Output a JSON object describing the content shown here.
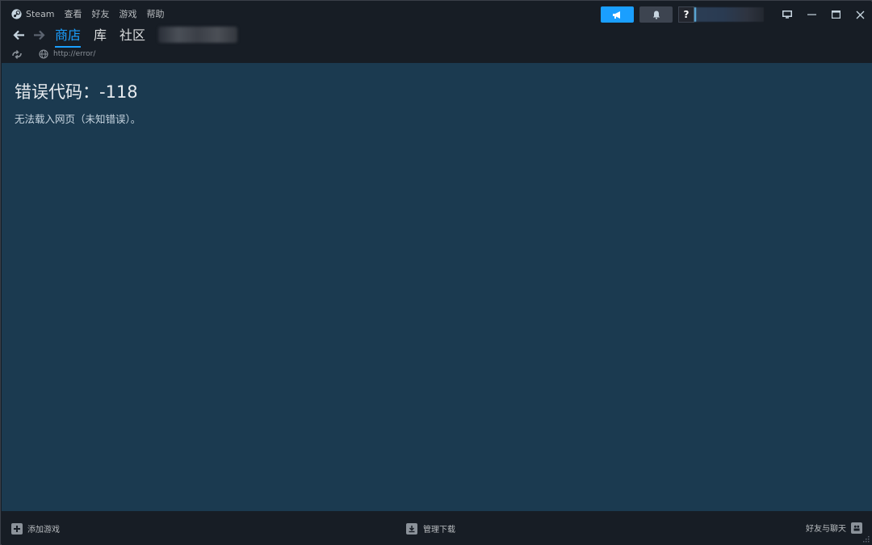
{
  "app": {
    "name": "Steam"
  },
  "menu": {
    "items": [
      "查看",
      "好友",
      "游戏",
      "帮助"
    ]
  },
  "account": {
    "help_label": "?"
  },
  "nav": {
    "tabs": [
      {
        "label": "商店",
        "active": true
      },
      {
        "label": "库",
        "active": false
      },
      {
        "label": "社区",
        "active": false
      }
    ]
  },
  "url": {
    "value": "http://error/"
  },
  "error": {
    "title": "错误代码：-118",
    "message": "无法载入网页（未知错误）。"
  },
  "footer": {
    "add_game": "添加游戏",
    "manage_downloads": "管理下载",
    "friends_chat": "好友与聊天"
  },
  "colors": {
    "accent": "#1a9fff",
    "content_bg": "#1b3a50",
    "chrome_bg": "#171d25"
  },
  "icons": {
    "steam": "steam-logo-icon",
    "announce": "megaphone-icon",
    "notify": "bell-icon",
    "back": "arrow-left-icon",
    "forward": "arrow-right-icon",
    "reload": "reload-icon",
    "globe": "globe-icon",
    "minimize": "minimize-icon",
    "maximize": "maximize-icon",
    "close": "close-icon",
    "big_picture": "monitor-icon",
    "add": "plus-square-icon",
    "download": "download-icon",
    "friends": "friends-icon"
  }
}
